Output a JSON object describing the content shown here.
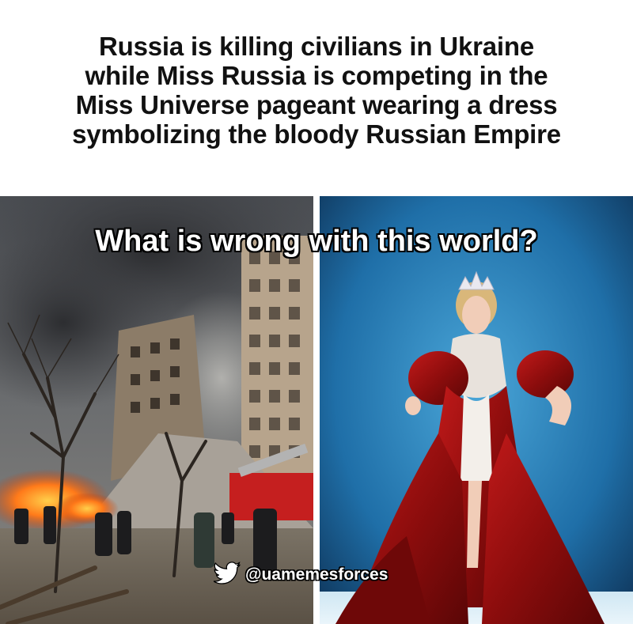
{
  "headline": {
    "lines": [
      "Russia is killing civilians in Ukraine",
      "while Miss Russia is competing in the",
      "Miss Universe pageant wearing a dress",
      "symbolizing the bloody Russian Empire"
    ]
  },
  "overlay_caption": "What is wrong with this world?",
  "watermark": {
    "icon": "twitter-bird-icon",
    "handle": "@uamemesforces"
  },
  "photos": {
    "left": {
      "subject": "destroyed-apartment-building-photo"
    },
    "right": {
      "subject": "pageant-red-dress-photo"
    }
  },
  "colors": {
    "background": "#ffffff",
    "headline_text": "#111111",
    "caption_text": "#ffffff",
    "dress_red": "#9b1010",
    "stage_blue": "#1f6fa8"
  }
}
